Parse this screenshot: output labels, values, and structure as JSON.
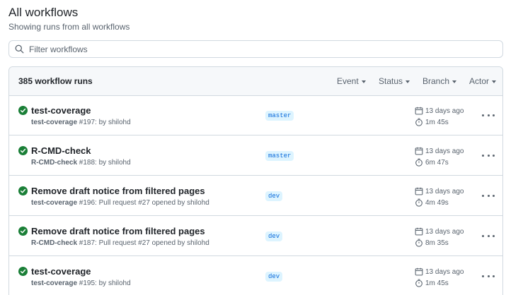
{
  "header": {
    "title": "All workflows",
    "subtitle": "Showing runs from all workflows"
  },
  "search": {
    "placeholder": "Filter workflows",
    "value": ""
  },
  "runs_header": {
    "count_label": "385 workflow runs",
    "filters": [
      "Event",
      "Status",
      "Branch",
      "Actor"
    ]
  },
  "colors": {
    "success": "#1a7f37",
    "branch_bg": "#ddf4ff",
    "branch_fg": "#0969da",
    "muted": "#59636e"
  },
  "runs": [
    {
      "status": "success",
      "title": "test-coverage",
      "workflow": "test-coverage",
      "meta_rest": " #197: by shilohd",
      "branch": "master",
      "date": "13 days ago",
      "duration": "1m 45s"
    },
    {
      "status": "success",
      "title": "R-CMD-check",
      "workflow": "R-CMD-check",
      "meta_rest": " #188: by shilohd",
      "branch": "master",
      "date": "13 days ago",
      "duration": "6m 47s"
    },
    {
      "status": "success",
      "title": "Remove draft notice from filtered pages",
      "workflow": "test-coverage",
      "meta_rest": " #196: Pull request #27 opened by shilohd",
      "branch": "dev",
      "date": "13 days ago",
      "duration": "4m 49s"
    },
    {
      "status": "success",
      "title": "Remove draft notice from filtered pages",
      "workflow": "R-CMD-check",
      "meta_rest": " #187: Pull request #27 opened by shilohd",
      "branch": "dev",
      "date": "13 days ago",
      "duration": "8m 35s"
    },
    {
      "status": "success",
      "title": "test-coverage",
      "workflow": "test-coverage",
      "meta_rest": " #195: by shilohd",
      "branch": "dev",
      "date": "13 days ago",
      "duration": "1m 45s"
    }
  ]
}
